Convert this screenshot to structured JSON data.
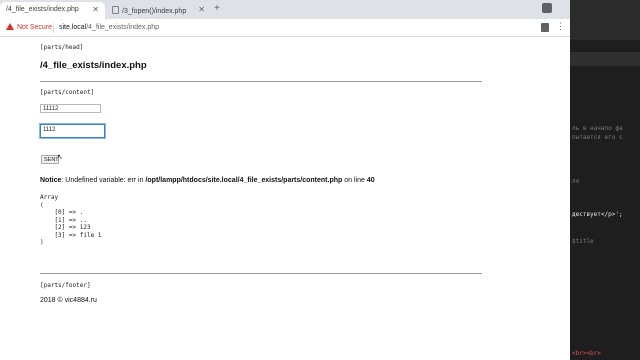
{
  "browser": {
    "tabs": [
      {
        "label": "/4_file_exists/index.php",
        "active": true
      },
      {
        "label": "/3_fopen()/index.php",
        "active": false
      }
    ],
    "new_tab": "+",
    "security_label": "Not Secure",
    "url_host": "site.local",
    "url_path": "/4_file_exists/index.php"
  },
  "page": {
    "head_marker": "[parts/head]",
    "title": "/4_file_exists/index.php",
    "content_marker": "[parts/content]",
    "input1_value": "11112",
    "input2_value": "1112",
    "submit_label": "SENT",
    "notice_label": "Notice",
    "notice_text": ": Undefined variable: err in ",
    "notice_path": "/opt/lampp/htdocs/site.local/4_file_exists/parts/content.php",
    "notice_online": " on line ",
    "notice_line": "40",
    "array_dump": "Array\n(\n    [0] => .\n    [1] => ..\n    [2] => 123\n    [3] => file 1\n)",
    "footer_marker": "[parts/footer]",
    "copyright": "2018 © vic4884.ru"
  },
  "editor": {
    "lines": [
      {
        "text": "ль в начало фа",
        "color": "#7a7a7a"
      },
      {
        "text": "пытается его с",
        "color": "#7a7a7a"
      },
      {
        "text": "ля",
        "color": "#7a7a7a"
      },
      {
        "text": "дествует</p>';",
        "color": "#e8e8e8"
      },
      {
        "text": "$title",
        "color": "#7a7a7a"
      },
      {
        "text": "<br><br>",
        "color": "#d9534f"
      }
    ]
  },
  "colors": {
    "warning": "#d93025",
    "focus_ring": "#3b82c4",
    "editor_bg": "#1e1e1e"
  }
}
